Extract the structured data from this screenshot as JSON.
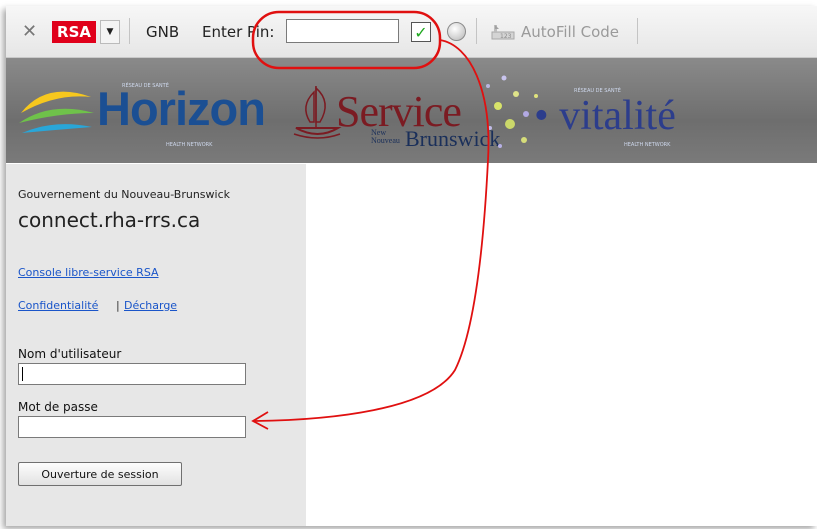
{
  "toolbar": {
    "close_glyph": "✕",
    "rsa_logo": "RSA",
    "dropdown_glyph": "▼",
    "gnb_label": "GNB",
    "enter_pin_label": "Enter Pin:",
    "pin_value": "",
    "check_glyph": "✓",
    "autofill_label": "AutoFill Code"
  },
  "banner": {
    "horizon": "Horizon",
    "horizon_small_top": "RÉSEAU DE SANTÉ",
    "horizon_small_bottom": "HEALTH NETWORK",
    "service": "Service",
    "new_nouveau": "New\nNouveau",
    "brunswick": "Brunswick",
    "vitalite": "• vitalité",
    "vitalite_small_top": "RÉSEAU DE SANTÉ",
    "vitalite_small_bottom": "HEALTH NETWORK"
  },
  "sidebar": {
    "government": "Gouvernement du Nouveau-Brunswick",
    "domain": "connect.rha-rrs.ca",
    "console_link": "Console libre-service RSA",
    "privacy_link": "Confidentialité",
    "separator": "|",
    "disclaimer_link": "Décharge",
    "username_label": "Nom d'utilisateur",
    "username_value": "",
    "password_label": "Mot de passe",
    "password_value": "",
    "login_button": "Ouverture de session"
  },
  "colors": {
    "rsa_red": "#e0001b",
    "annotation_red": "#e01010",
    "link_blue": "#1a55c9",
    "horizon_blue": "#1b4f93",
    "service_maroon": "#7b1b22",
    "vitalite_blue": "#2c3d8c"
  }
}
